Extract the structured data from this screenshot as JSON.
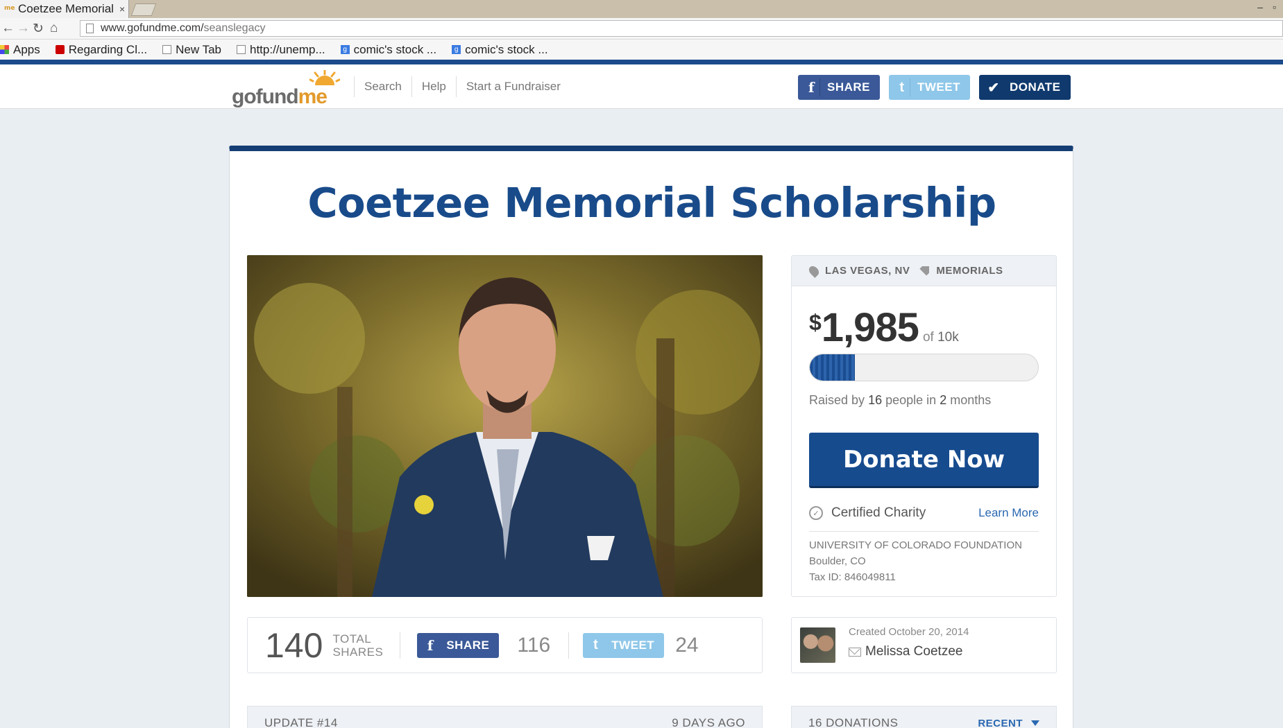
{
  "browser": {
    "tab_title": "Coetzee Memorial",
    "tab_favicon": "gofundme",
    "tab_close": "×",
    "url_domain": "www.gofundme.com/",
    "url_path": "seanslegacy",
    "bookmarks": [
      {
        "label": "Apps",
        "icon": "apps-icon"
      },
      {
        "label": "Regarding Cl...",
        "icon": "youtube-icon"
      },
      {
        "label": "New Tab",
        "icon": "page-icon"
      },
      {
        "label": "http://unemp...",
        "icon": "page-icon"
      },
      {
        "label": "comic's stock ...",
        "icon": "google-icon"
      },
      {
        "label": "comic's stock ...",
        "icon": "google-icon"
      }
    ]
  },
  "header": {
    "logo_go": "gofund",
    "logo_me": "me",
    "nav": [
      "Search",
      "Help",
      "Start a Fundraiser"
    ],
    "share_label": "SHARE",
    "tweet_label": "TWEET",
    "donate_label": "DONATE"
  },
  "campaign": {
    "title": "Coetzee Memorial Scholarship",
    "location": "LAS VEGAS, NV",
    "category": "MEMORIALS",
    "currency": "$",
    "raised": "1,985",
    "goal_prefix": "of",
    "goal": "10k",
    "progress_fraction": 0.1985,
    "raised_by_prefix": "Raised by",
    "people_count": "16",
    "people_word": "people in",
    "duration": "2",
    "duration_unit": "months",
    "donate_now": "Donate Now",
    "certified": "Certified Charity",
    "learn_more": "Learn More",
    "org_name": "UNIVERSITY OF COLORADO FOUNDATION",
    "org_location": "Boulder, CO",
    "org_tax": "Tax ID: 846049811"
  },
  "shares": {
    "total": "140",
    "total_label_1": "TOTAL",
    "total_label_2": "SHARES",
    "share_label": "SHARE",
    "share_count": "116",
    "tweet_label": "TWEET",
    "tweet_count": "24"
  },
  "creator": {
    "created": "Created October 20, 2014",
    "name": "Melissa Coetzee"
  },
  "update": {
    "label": "UPDATE #14",
    "when": "9 DAYS AGO"
  },
  "donations": {
    "label": "16 DONATIONS",
    "sort": "RECENT"
  },
  "colors": {
    "brand_blue": "#194b8a",
    "facebook": "#3b5998",
    "twitter": "#8ec7e9",
    "donate_dark": "#103a6e"
  }
}
